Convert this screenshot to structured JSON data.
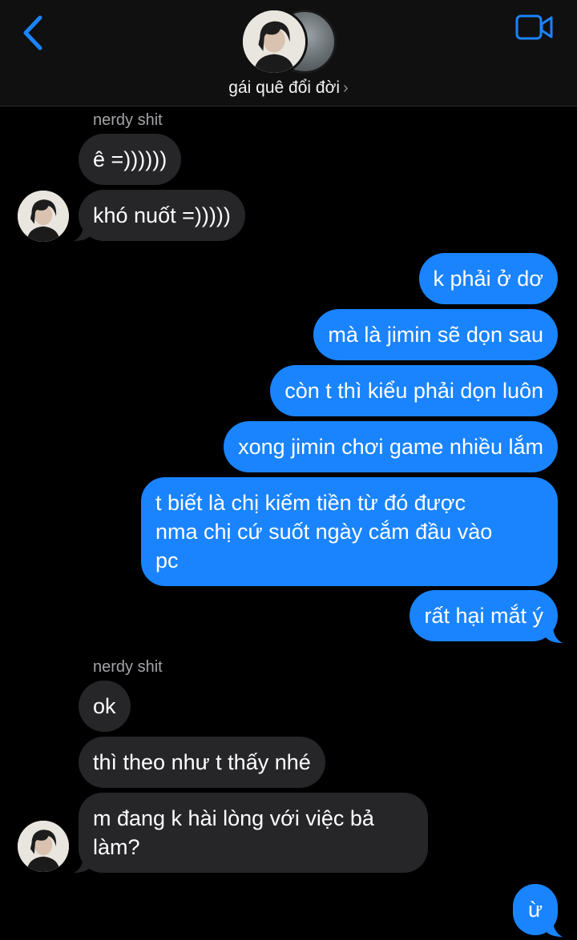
{
  "header": {
    "title": "gái quê đổi đời",
    "title_chevron": "›",
    "back_icon": "chevron-left-icon",
    "video_icon": "video-camera-icon",
    "accent_color": "#1a84ff"
  },
  "messages": [
    {
      "sender_label": "nerdy shit"
    },
    {
      "direction": "incoming",
      "text": "ê =))))))"
    },
    {
      "direction": "incoming",
      "text": "khó nuốt =)))))"
    },
    {
      "direction": "outgoing",
      "text": "k phải ở dơ"
    },
    {
      "direction": "outgoing",
      "text": "mà là jimin sẽ dọn sau"
    },
    {
      "direction": "outgoing",
      "text": "còn t thì kiểu phải dọn luôn"
    },
    {
      "direction": "outgoing",
      "text": "xong jimin chơi game nhiều lắm"
    },
    {
      "direction": "outgoing",
      "lines": [
        "t biết là chị kiếm tiền từ đó được",
        "nma chị cứ suốt ngày cắm đầu vào",
        "pc"
      ]
    },
    {
      "direction": "outgoing",
      "text": "rất hại mắt ý"
    },
    {
      "sender_label": "nerdy shit"
    },
    {
      "direction": "incoming",
      "text": "ok"
    },
    {
      "direction": "incoming",
      "text": "thì theo như t thấy nhé"
    },
    {
      "direction": "incoming",
      "lines": [
        "m đang k hài lòng với việc bả",
        "làm?"
      ]
    },
    {
      "direction": "outgoing",
      "text": "ừ"
    }
  ],
  "colors": {
    "incoming_bubble": "#262629",
    "outgoing_bubble": "#1a84ff",
    "background": "#000000"
  }
}
